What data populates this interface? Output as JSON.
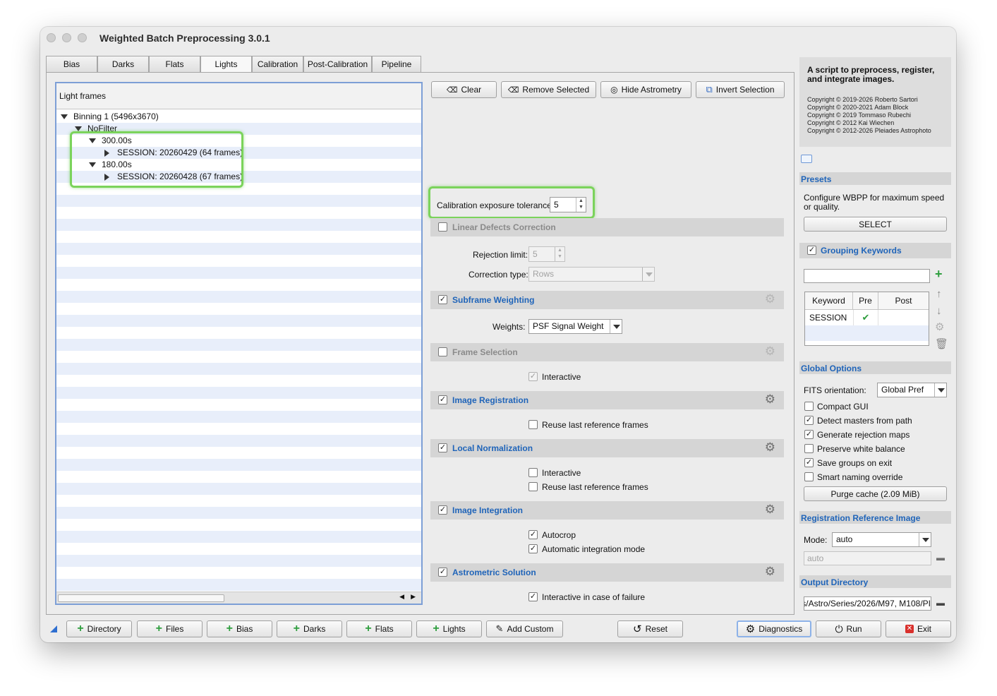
{
  "window": {
    "title": "Weighted Batch Preprocessing 3.0.1"
  },
  "tabs": [
    "Bias",
    "Darks",
    "Flats",
    "Lights",
    "Calibration",
    "Post-Calibration",
    "Pipeline"
  ],
  "tree": {
    "header": "Light frames",
    "binning": "Binning 1 (5496x3670)",
    "filter": "NoFilter",
    "exposure1": "300.00s",
    "session1": "SESSION: 20260429 (64 frames)",
    "exposure2": "180.00s",
    "session2": "SESSION: 20260428 (67 frames)"
  },
  "toolbar": {
    "clear": "Clear",
    "remove_selected": "Remove Selected",
    "hide_astrometry": "Hide Astrometry",
    "invert_selection": "Invert Selection"
  },
  "calibration": {
    "tolerance_label": "Calibration exposure tolerance:",
    "tolerance_value": "5"
  },
  "sections": {
    "linear_defects": {
      "title": "Linear Defects Correction",
      "rejection_label": "Rejection limit:",
      "rejection_value": "5",
      "correction_label": "Correction type:",
      "correction_value": "Rows"
    },
    "subframe_weighting": {
      "title": "Subframe Weighting",
      "weights_label": "Weights:",
      "weights_value": "PSF Signal Weight"
    },
    "frame_selection": {
      "title": "Frame Selection",
      "interactive": "Interactive"
    },
    "image_registration": {
      "title": "Image Registration",
      "reuse": "Reuse last reference frames"
    },
    "local_normalization": {
      "title": "Local Normalization",
      "interactive": "Interactive",
      "reuse": "Reuse last reference frames"
    },
    "image_integration": {
      "title": "Image Integration",
      "autocrop": "Autocrop",
      "auto_mode": "Automatic integration mode"
    },
    "astrometric_solution": {
      "title": "Astrometric Solution",
      "interactive_failure": "Interactive in case of failure"
    }
  },
  "about": {
    "heading": "A script to preprocess, register, and integrate images.",
    "copyrights": [
      "Copyright © 2019-2026 Roberto Sartori",
      "Copyright © 2020-2021 Adam Block",
      "Copyright © 2019 Tommaso Rubechi",
      "Copyright © 2012 Kai Wiechen",
      "Copyright © 2012-2026 Pleiades Astrophoto"
    ]
  },
  "presets": {
    "title": "Presets",
    "description": "Configure WBPP for maximum speed or quality.",
    "select": "SELECT"
  },
  "grouping": {
    "title": "Grouping Keywords",
    "col_keyword": "Keyword",
    "col_pre": "Pre",
    "col_post": "Post",
    "row_keyword": "SESSION",
    "row_pre": "✔"
  },
  "global_options": {
    "title": "Global Options",
    "fits_label": "FITS orientation:",
    "fits_value": "Global Pref",
    "compact_gui": "Compact GUI",
    "detect_masters": "Detect masters from path",
    "generate_rejection": "Generate rejection maps",
    "preserve_white": "Preserve white balance",
    "save_groups": "Save groups on exit",
    "smart_naming": "Smart naming override",
    "purge_cache": "Purge cache (2.09 MiB)"
  },
  "registration_ref": {
    "title": "Registration Reference Image",
    "mode_label": "Mode:",
    "mode_value": "auto",
    "path_value": "auto"
  },
  "output_dir": {
    "title": "Output Directory",
    "value": "s/Astro/Series/2026/M97, M108/PI"
  },
  "bottom": {
    "directory": "Directory",
    "files": "Files",
    "bias": "Bias",
    "darks": "Darks",
    "flats": "Flats",
    "lights": "Lights",
    "add_custom": "Add Custom",
    "reset": "Reset",
    "diagnostics": "Diagnostics",
    "run": "Run",
    "exit": "Exit"
  },
  "colors": {
    "accent": "#1f64b9",
    "highlight": "#7bd35b",
    "add_green": "#2e9e3e",
    "exit_red": "#d9302c"
  }
}
